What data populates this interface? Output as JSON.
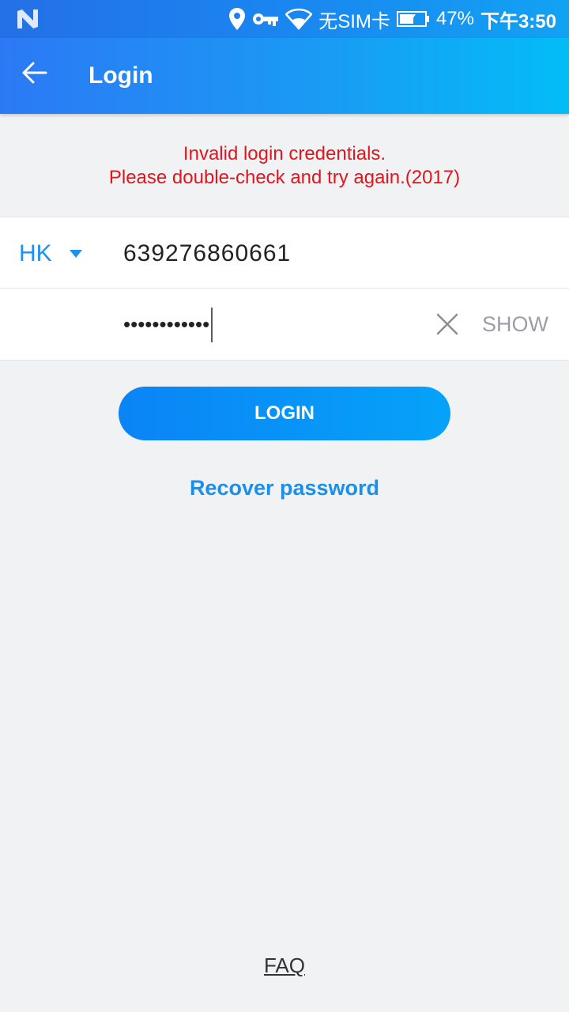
{
  "status_bar": {
    "carrier": "无SIM卡",
    "battery": "47%",
    "time": "下午3:50",
    "icons": [
      "notification-n-icon",
      "location-icon",
      "vpn-key-icon",
      "wifi-icon",
      "battery-icon"
    ]
  },
  "app_bar": {
    "title": "Login",
    "back_icon": "back-arrow-icon"
  },
  "error": {
    "line1": "Invalid login credentials.",
    "line2": "Please double-check and try again.(2017)"
  },
  "phone": {
    "country_code": "HK",
    "number": "639276860661"
  },
  "password": {
    "masked_value": "••••••••••••",
    "show_label": "SHOW"
  },
  "actions": {
    "login_label": "LOGIN",
    "recover_label": "Recover password",
    "faq_label": "FAQ"
  },
  "colors": {
    "accent": "#1f8ff0",
    "error": "#e0161f",
    "background": "#f1f2f4"
  }
}
